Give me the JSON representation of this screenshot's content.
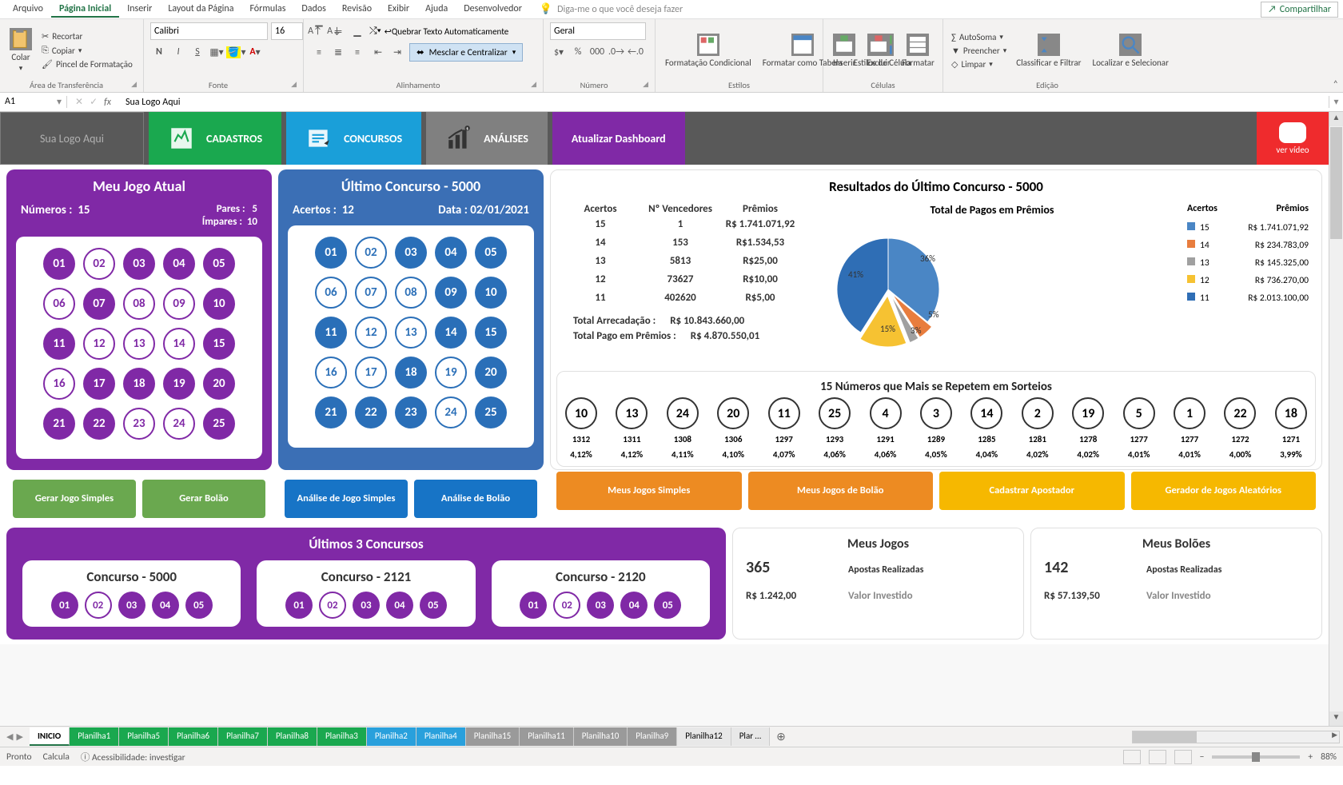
{
  "menubar": {
    "items": [
      "Arquivo",
      "Página Inicial",
      "Inserir",
      "Layout da Página",
      "Fórmulas",
      "Dados",
      "Revisão",
      "Exibir",
      "Ajuda",
      "Desenvolvedor"
    ],
    "active_index": 1,
    "tellme": "Diga-me o que você deseja fazer",
    "share": "Compartilhar"
  },
  "ribbon": {
    "clipboard": {
      "paste": "Colar",
      "cut": "Recortar",
      "copy": "Copiar",
      "painter": "Pincel de Formatação",
      "label": "Área de Transferência"
    },
    "font": {
      "name": "Calibri",
      "size": "16",
      "label": "Fonte"
    },
    "align": {
      "wrap": "Quebrar Texto Automaticamente",
      "merge": "Mesclar e Centralizar",
      "label": "Alinhamento"
    },
    "number": {
      "format": "Geral",
      "label": "Número"
    },
    "styles": {
      "cond": "Formatação Condicional",
      "table": "Formatar como Tabela",
      "cell": "Estilos de Célula",
      "label": "Estilos"
    },
    "cells": {
      "insert": "Inserir",
      "delete": "Excluir",
      "format": "Formatar",
      "label": "Células"
    },
    "edit": {
      "sum": "AutoSoma",
      "fill": "Preencher",
      "clear": "Limpar",
      "sort": "Classificar e Filtrar",
      "find": "Localizar e Selecionar",
      "label": "Edição"
    }
  },
  "formula_bar": {
    "name": "A1",
    "content": "Sua Logo Aqui"
  },
  "dash": {
    "logo": "Sua Logo Aqui",
    "nav": [
      {
        "label": "CADASTROS"
      },
      {
        "label": "CONCURSOS"
      },
      {
        "label": "ANÁLISES"
      },
      {
        "label": "Atualizar Dashboard"
      }
    ],
    "video": "ver vídeo",
    "meu_jogo": {
      "title": "Meu Jogo Atual",
      "numeros_label": "Números :",
      "numeros": "15",
      "pares_label": "Pares :",
      "pares": "5",
      "impares_label": "Ímpares :",
      "impares": "10",
      "balls": [
        "01",
        "02",
        "03",
        "04",
        "05",
        "06",
        "07",
        "08",
        "09",
        "10",
        "11",
        "12",
        "13",
        "14",
        "15",
        "16",
        "17",
        "18",
        "19",
        "20",
        "21",
        "22",
        "23",
        "24",
        "25"
      ],
      "selected": [
        0,
        2,
        3,
        4,
        6,
        9,
        10,
        14,
        16,
        17,
        18,
        19,
        20,
        21,
        24
      ],
      "btn1": "Gerar Jogo Simples",
      "btn2": "Gerar Bolão"
    },
    "ultimo": {
      "title": "Último Concurso - 5000",
      "acertos_label": "Acertos :",
      "acertos": "12",
      "data_label": "Data :",
      "data": "02/01/2021",
      "balls": [
        "01",
        "02",
        "03",
        "04",
        "05",
        "06",
        "07",
        "08",
        "09",
        "10",
        "11",
        "12",
        "13",
        "14",
        "15",
        "16",
        "17",
        "18",
        "19",
        "20",
        "21",
        "22",
        "23",
        "24",
        "25"
      ],
      "selected": [
        0,
        2,
        3,
        4,
        8,
        9,
        10,
        13,
        14,
        17,
        19,
        20,
        21,
        22,
        24
      ],
      "btn1": "Análise de Jogo Simples",
      "btn2": "Análise de Bolão"
    },
    "resultados": {
      "title": "Resultados do Último Concurso - 5000",
      "headers": [
        "Acertos",
        "Nº Vencedores",
        "Prêmios"
      ],
      "rows": [
        [
          "15",
          "1",
          "R$ 1.741.071,92"
        ],
        [
          "14",
          "153",
          "R$1.534,53"
        ],
        [
          "13",
          "5813",
          "R$25,00"
        ],
        [
          "12",
          "73627",
          "R$10,00"
        ],
        [
          "11",
          "402620",
          "R$5,00"
        ]
      ],
      "tot_arr_label": "Total Arrecadação :",
      "tot_arr": "R$ 10.843.660,00",
      "tot_pag_label": "Total Pago em Prêmios :",
      "tot_pag": "R$ 4.870.550,01"
    },
    "chart_data": {
      "type": "pie",
      "title": "Total de Pagos em Prêmios",
      "legend_headers": [
        "Acertos",
        "Prêmios"
      ],
      "series": [
        {
          "name": "15",
          "value": 1741071.92,
          "pct": 36,
          "color": "#4a86c5",
          "premio": "R$ 1.741.071,92"
        },
        {
          "name": "14",
          "value": 234783.09,
          "pct": 5,
          "color": "#e87d3e",
          "premio": "R$ 234.783,09"
        },
        {
          "name": "13",
          "value": 145325.0,
          "pct": 3,
          "color": "#a0a0a0",
          "premio": "R$ 145.325,00"
        },
        {
          "name": "12",
          "value": 736270.0,
          "pct": 15,
          "color": "#f6c232",
          "premio": "R$ 736.270,00"
        },
        {
          "name": "11",
          "value": 2013100.0,
          "pct": 41,
          "color": "#2f6eb5",
          "premio": "R$ 2.013.100,00"
        }
      ]
    },
    "hot": {
      "title": "15 Números que Mais se Repetem em Sorteios",
      "nums": [
        "10",
        "13",
        "24",
        "20",
        "11",
        "25",
        "4",
        "3",
        "14",
        "2",
        "19",
        "5",
        "1",
        "22",
        "18"
      ],
      "counts": [
        "1312",
        "1311",
        "1308",
        "1306",
        "1297",
        "1293",
        "1291",
        "1289",
        "1285",
        "1281",
        "1278",
        "1277",
        "1277",
        "1272",
        "1271"
      ],
      "pcts": [
        "4,12%",
        "4,12%",
        "4,11%",
        "4,10%",
        "4,07%",
        "4,06%",
        "4,06%",
        "4,05%",
        "4,04%",
        "4,02%",
        "4,02%",
        "4,01%",
        "4,01%",
        "4,00%",
        "3,99%"
      ]
    },
    "mid_buttons": [
      "Meus Jogos Simples",
      "Meus Jogos de Bolão",
      "Cadastrar Apostador",
      "Gerador de Jogos Aleatórios"
    ],
    "ultimos3": {
      "title": "Últimos 3  Concursos",
      "cards": [
        {
          "title": "Concurso - 5000",
          "balls": [
            "01",
            "02",
            "03",
            "04",
            "05"
          ],
          "sel": [
            0,
            2,
            3,
            4
          ]
        },
        {
          "title": "Concurso - 2121",
          "balls": [
            "01",
            "02",
            "03",
            "04",
            "05"
          ],
          "sel": [
            0,
            2,
            3,
            4
          ]
        },
        {
          "title": "Concurso - 2120",
          "balls": [
            "01",
            "02",
            "03",
            "04",
            "05"
          ],
          "sel": [
            0,
            2,
            3,
            4
          ]
        }
      ]
    },
    "meus_jogos": {
      "title": "Meus Jogos",
      "n": "365",
      "label": "Apostas Realizadas",
      "v": "R$ 1.242,00",
      "vlabel": "Valor Investido"
    },
    "meus_boloes": {
      "title": "Meus Bolões",
      "n": "142",
      "label": "Apostas Realizadas",
      "v": "R$ 57.139,50",
      "vlabel": "Valor Investido"
    }
  },
  "sheet_tabs": [
    "INICIO",
    "Planilha1",
    "Planilha5",
    "Planilha6",
    "Planilha7",
    "Planilha8",
    "Planilha3",
    "Planilha2",
    "Planilha4",
    "Planilha15",
    "Planilha11",
    "Planilha10",
    "Planilha9",
    "Planilha12",
    "Plar …"
  ],
  "tab_colors": [
    "active",
    "green",
    "green",
    "green",
    "green",
    "green",
    "green",
    "blue",
    "blue",
    "gray",
    "gray",
    "gray",
    "gray",
    "",
    ""
  ],
  "status": {
    "ready": "Pronto",
    "calc": "Calcula",
    "acc": "Acessibilidade: investigar",
    "zoom": "88%"
  }
}
